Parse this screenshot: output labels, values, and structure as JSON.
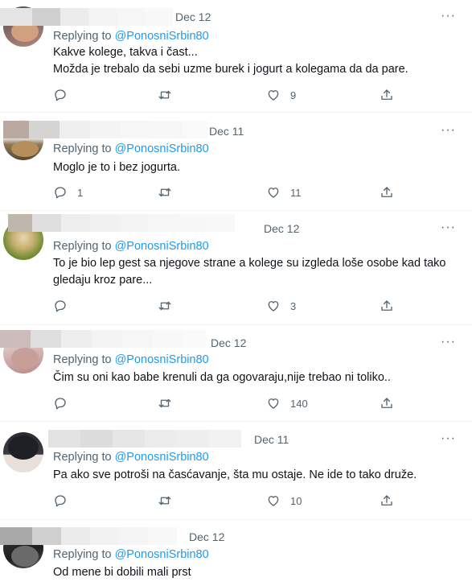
{
  "tweets": [
    {
      "date": "Dec 12",
      "replying_prefix": "Replying to",
      "handle": "@PonosniSrbin80",
      "lines": [
        "Kakve kolege, takva i čast...",
        "Možda je trebalo da sebi uzme burek i jogurt a kolegama da da pare."
      ],
      "replies": "",
      "retweets": "",
      "likes": "9"
    },
    {
      "date": "Dec 11",
      "replying_prefix": "Replying to",
      "handle": "@PonosniSrbin80",
      "lines": [
        "Moglo je to i bez jogurta."
      ],
      "replies": "1",
      "retweets": "",
      "likes": "11"
    },
    {
      "date": "Dec 12",
      "replying_prefix": "Replying to",
      "handle": "@PonosniSrbin80",
      "lines": [
        "To je bio lep gest sa njegove strane a kolege su izgleda loše osobe kad tako",
        "gledaju kroz pare..."
      ],
      "replies": "",
      "retweets": "",
      "likes": "3"
    },
    {
      "date": "Dec 12",
      "replying_prefix": "Replying to",
      "handle": "@PonosniSrbin80",
      "lines": [
        "Čim su oni kao babe krenuli da ga ogovaraju,nije trebao ni toliko.."
      ],
      "replies": "",
      "retweets": "",
      "likes": "140"
    },
    {
      "date": "Dec 11",
      "replying_prefix": "Replying to",
      "handle": "@PonosniSrbin80",
      "lines": [
        "Pa ako sve potroši na časćavanje, šta mu ostaje. Ne ide to tako druže."
      ],
      "replies": "",
      "retweets": "",
      "likes": "10"
    },
    {
      "date": "Dec 12",
      "replying_prefix": "Replying to",
      "handle": "@PonosniSrbin80",
      "lines": [
        "Od mene bi dobili mali prst"
      ],
      "replies": "",
      "retweets": "",
      "likes": ""
    }
  ],
  "more_glyph": "···",
  "icons": {
    "reply": "reply-icon",
    "retweet": "retweet-icon",
    "like": "like-icon",
    "share": "share-icon",
    "more": "more-icon"
  },
  "colors": {
    "link": "#1d9bf0",
    "secondary": "#536471",
    "text": "#0f1419",
    "divider": "#eff3f4"
  }
}
